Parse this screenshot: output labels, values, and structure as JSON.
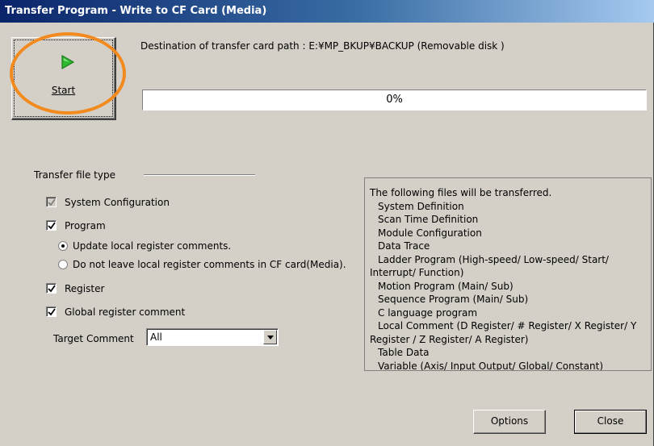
{
  "window": {
    "title": "Transfer Program - Write to CF Card (Media)"
  },
  "start_button": {
    "label": "Start",
    "icon": "play-icon",
    "icon_color": "#2db82d"
  },
  "highlight_color": "#f28a1e",
  "destination": {
    "text": "Destination of transfer card path : E:¥MP_BKUP¥BACKUP (Removable disk )"
  },
  "progress": {
    "value_percent": 0,
    "text": "0%"
  },
  "transfer_file_type": {
    "group_label": "Transfer file type",
    "system_configuration": {
      "label": "System Configuration",
      "checked": true,
      "enabled": false
    },
    "program": {
      "label": "Program",
      "checked": true
    },
    "radio_update": {
      "label": "Update local register comments.",
      "selected": true
    },
    "radio_do_not_leave": {
      "label": "Do not leave local register comments in CF card(Media).",
      "selected": false
    },
    "register": {
      "label": "Register",
      "checked": true
    },
    "global_register_comment": {
      "label": "Global register comment",
      "checked": true
    },
    "target_comment": {
      "label": "Target Comment",
      "value": "All"
    }
  },
  "file_list": {
    "lines": [
      "The following files will be transferred.",
      "System Definition",
      "Scan Time Definition",
      "Module Configuration",
      "Data Trace",
      "Ladder Program (High-speed/ Low-speed/ Start/",
      "Interrupt/ Function)",
      "Motion Program (Main/ Sub)",
      "Sequence Program (Main/ Sub)",
      "C language program",
      "Local Comment (D Register/ # Register/ X Register/ Y",
      "Register / Z Register/ A Register)",
      "Table Data",
      "Variable (Axis/ Input Output/ Global/ Constant)"
    ]
  },
  "buttons": {
    "options": "Options",
    "close": "Close"
  }
}
